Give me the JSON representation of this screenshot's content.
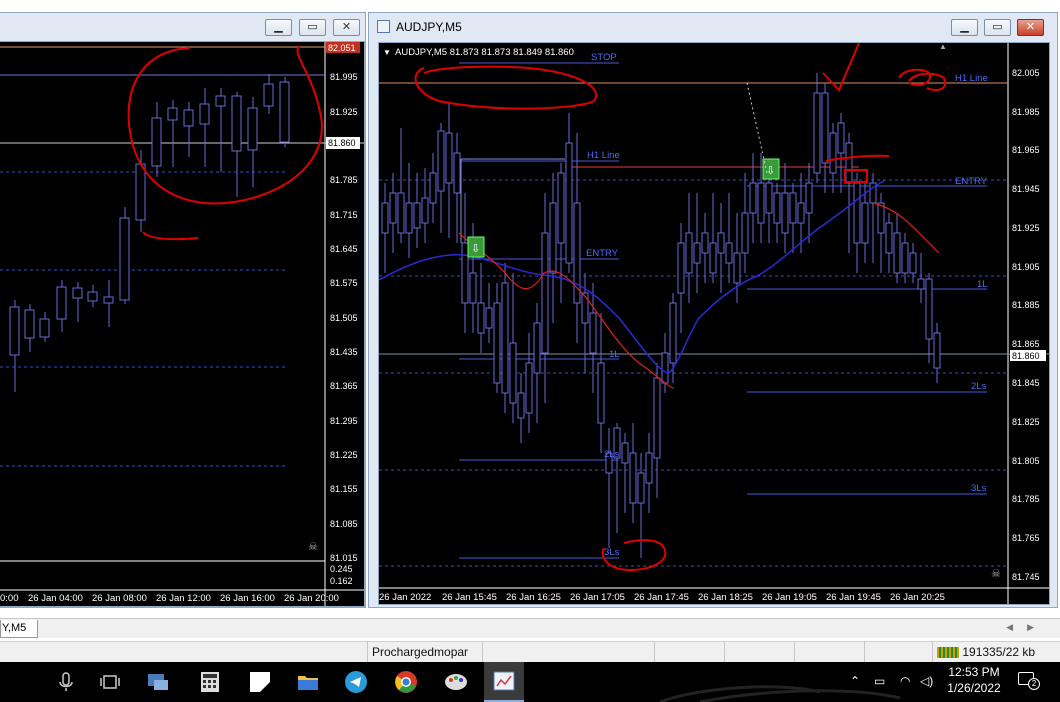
{
  "left_window": {
    "price_ticks": [
      "81.995",
      "81.925",
      "81.785",
      "81.715",
      "81.645",
      "81.575",
      "81.505",
      "81.435",
      "81.365",
      "81.295",
      "81.225",
      "81.155",
      "81.085",
      "81.015"
    ],
    "highlighted_prices": {
      "top_red": "82.051",
      "current": "81.860"
    },
    "indicator_ticks": [
      "0.245",
      "0.162"
    ],
    "time_labels": [
      "0:00",
      "26 Jan 04:00",
      "26 Jan 08:00",
      "26 Jan 12:00",
      "26 Jan 16:00",
      "26 Jan 20:00"
    ]
  },
  "right_window": {
    "title": "AUDJPY,M5",
    "header": "AUDJPY,M5  81.873 81.873 81.849 81.860",
    "price_ticks": [
      "82.005",
      "81.985",
      "81.965",
      "81.945",
      "81.925",
      "81.905",
      "81.885",
      "81.865",
      "81.845",
      "81.825",
      "81.805",
      "81.785",
      "81.765",
      "81.745"
    ],
    "current_price": "81.860",
    "time_labels": [
      "26 Jan 2022",
      "26 Jan 15:45",
      "26 Jan 16:25",
      "26 Jan 17:05",
      "26 Jan 17:45",
      "26 Jan 18:25",
      "26 Jan 19:05",
      "26 Jan 19:45",
      "26 Jan 20:25"
    ],
    "line_labels": [
      "STOP",
      "H1 Line",
      "H1 Line",
      "ENTRY",
      "ENTRY",
      "1L",
      "1L",
      "2Ls",
      "2Ls",
      "3Ls",
      "3Ls"
    ]
  },
  "tab": {
    "label": "Y,M5"
  },
  "status": {
    "profile": "Prochargedmopar",
    "traffic": "191335/22 kb"
  },
  "clock": {
    "time": "12:53 PM",
    "date": "1/26/2022"
  },
  "notification_count": "2",
  "colors": {
    "chart_bg": "#000000",
    "candle": "#6a6ad6",
    "ma_blue": "#2a2ad8",
    "ma_red": "#e02020",
    "level_line": "#4a5cd8",
    "h1_line": "#e09060",
    "annotation": "#e00000"
  }
}
